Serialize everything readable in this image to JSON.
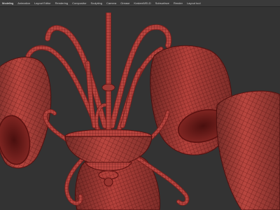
{
  "app": {
    "menu": [
      "Modeling",
      "Animation",
      "Layout Editor",
      "Rendering",
      "Compositor",
      "Sculpting",
      "Camera",
      "Grease",
      "KrakenWELD",
      "Subsurface",
      "Render",
      "Layout tool"
    ]
  },
  "colors": {
    "background": "#323232",
    "menubar": "#3a3a3a",
    "mesh_fill": "#b8453f",
    "mesh_dark": "#7a1f1d",
    "wire": "#5a1110"
  },
  "viewport": {
    "object": "chandelier-wireframe-model",
    "shading": "solid-with-wireframe-overlay"
  }
}
